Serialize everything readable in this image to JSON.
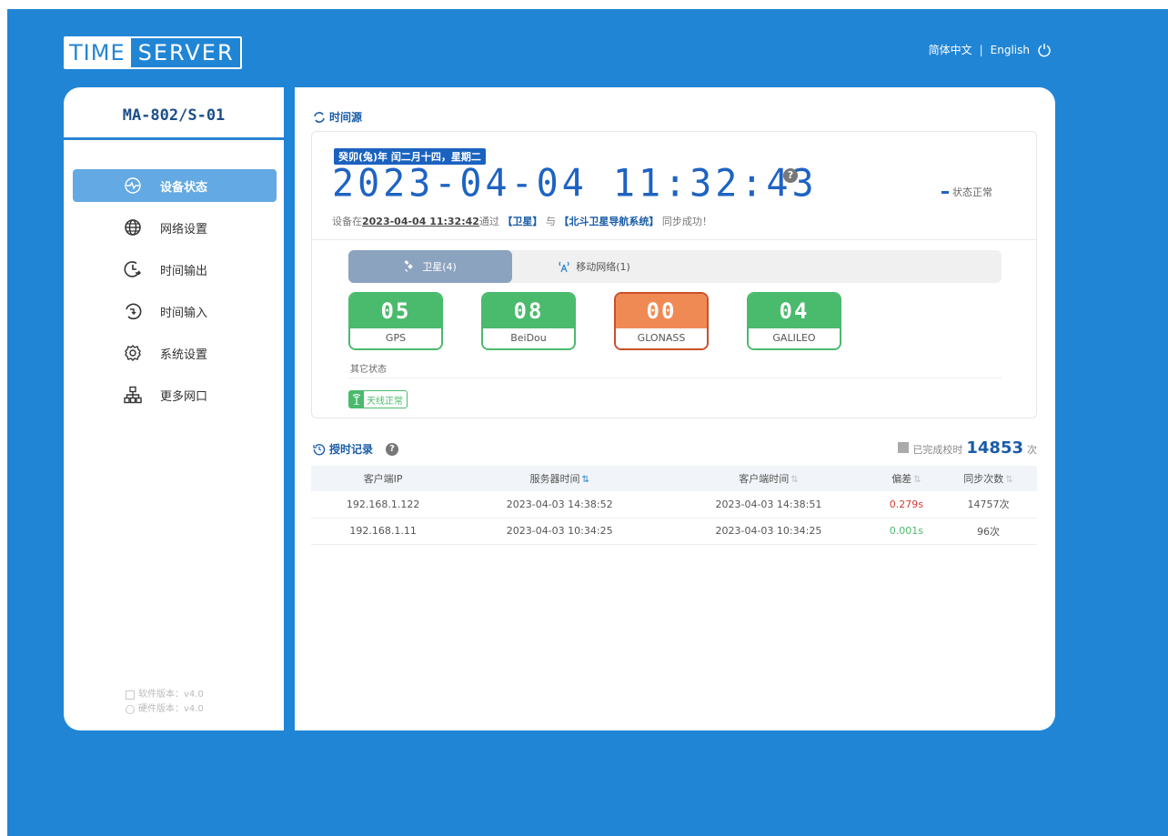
{
  "brand": {
    "part1": "TIME",
    "part2": "SERVER"
  },
  "header": {
    "lang_zh": "简体中文",
    "separator": "|",
    "lang_en": "English"
  },
  "sidebar": {
    "device_name": "MA-802/S-01",
    "items": [
      {
        "label": "设备状态",
        "icon": "status-icon",
        "active": true
      },
      {
        "label": "网络设置",
        "icon": "globe-icon",
        "active": false
      },
      {
        "label": "时间输出",
        "icon": "clock-out-icon",
        "active": false
      },
      {
        "label": "时间输入",
        "icon": "clock-in-icon",
        "active": false
      },
      {
        "label": "系统设置",
        "icon": "gear-icon",
        "active": false
      },
      {
        "label": "更多网口",
        "icon": "network-icon",
        "active": false
      }
    ],
    "software_version": "软件版本：v4.0",
    "hardware_version": "硬件版本：v4.0"
  },
  "time_source": {
    "title": "时间源",
    "lunar": "癸卯(兔)年 闰二月十四，星期二",
    "clock": "2023-04-04 11:32:43",
    "status": "状态正常",
    "sync_prefix": "设备在",
    "sync_time": "2023-04-04 11:32:42",
    "sync_via": "通过",
    "sync_src1": "【卫星】",
    "sync_and": "与",
    "sync_src2": "【北斗卫星导航系统】",
    "sync_suffix": "同步成功！",
    "tabs": [
      {
        "label": "卫星(4)",
        "active": true
      },
      {
        "label": "移动网络(1)",
        "active": false
      }
    ],
    "satellites": [
      {
        "count": "05",
        "name": "GPS",
        "status": "ok"
      },
      {
        "count": "08",
        "name": "BeiDou",
        "status": "ok"
      },
      {
        "count": "00",
        "name": "GLONASS",
        "status": "warn"
      },
      {
        "count": "04",
        "name": "GALILEO",
        "status": "ok"
      }
    ],
    "other_label": "其它状态",
    "antenna": "天线正常"
  },
  "records": {
    "title": "授时记录",
    "done_label": "已完成校时",
    "done_count": "14853",
    "done_unit": "次",
    "columns": [
      "客户端IP",
      "服务器时间",
      "客户端时间",
      "偏差",
      "同步次数"
    ],
    "rows": [
      {
        "ip": "192.168.1.122",
        "server_time": "2023-04-03 14:38:52",
        "client_time": "2023-04-03 14:38:51",
        "offset": "0.279s",
        "offset_state": "bad",
        "count": "14757次"
      },
      {
        "ip": "192.168.1.11",
        "server_time": "2023-04-03 10:34:25",
        "client_time": "2023-04-03 10:34:25",
        "offset": "0.001s",
        "offset_state": "good",
        "count": "96次"
      }
    ]
  },
  "colors": {
    "background": "#2185d5",
    "accent": "#1e63c2",
    "ok": "#4aba6c",
    "warn": "#f08a55"
  }
}
